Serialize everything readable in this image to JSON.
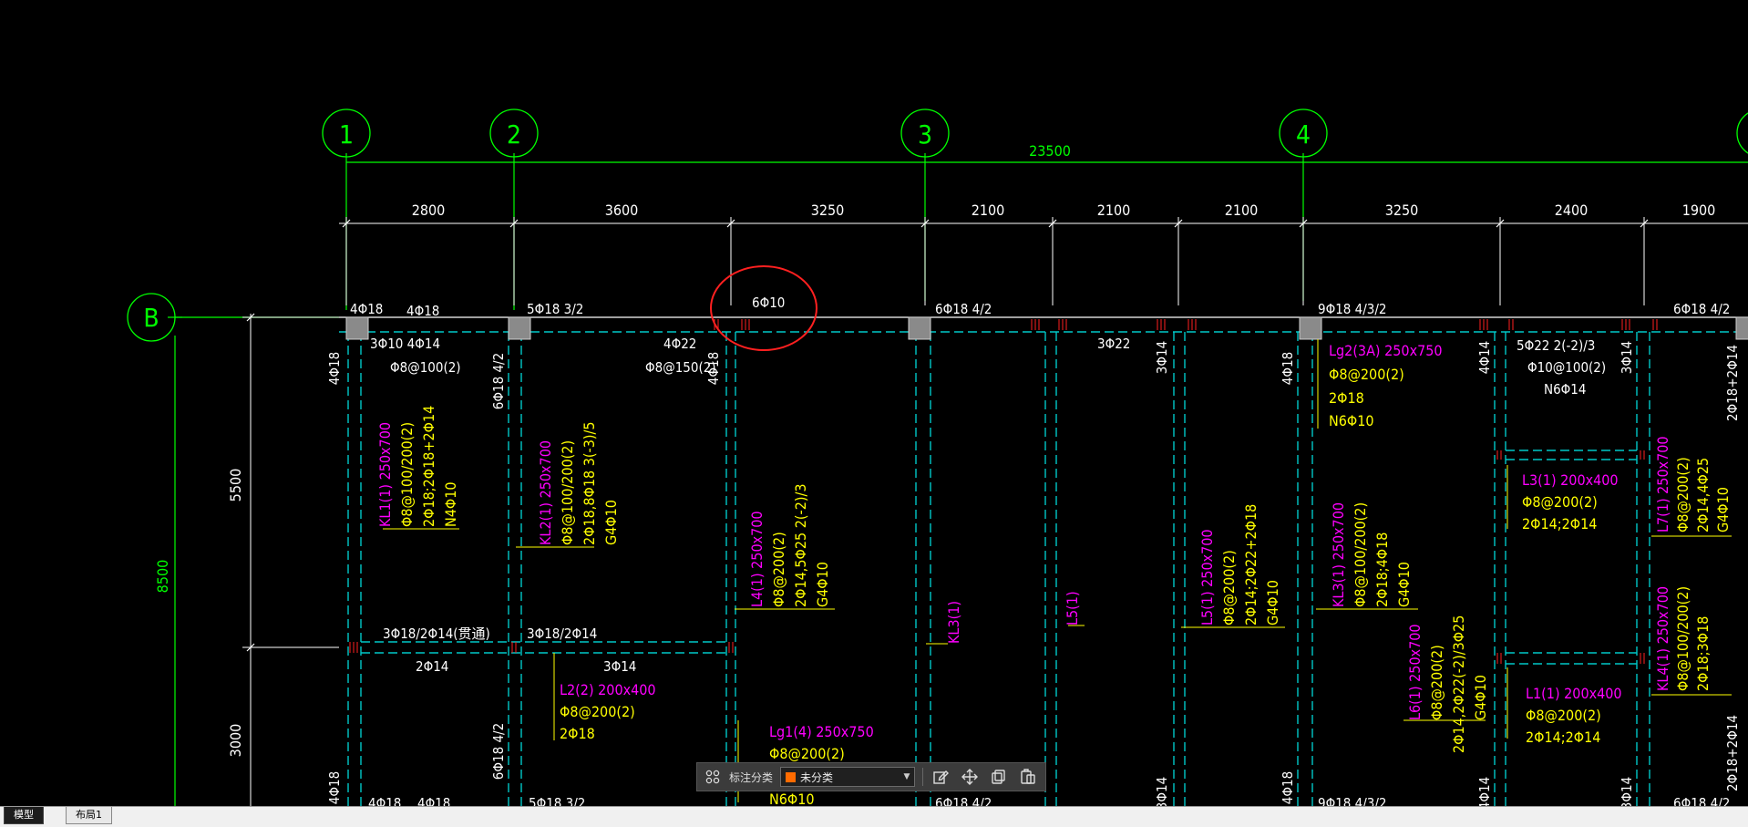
{
  "axes": {
    "columns": [
      "1",
      "2",
      "3",
      "4"
    ],
    "rows": [
      "B"
    ],
    "overall_dim": "23500",
    "left_dim": "8500"
  },
  "dims": {
    "spans": [
      "2800",
      "3600",
      "3250",
      "2100",
      "2100",
      "2100",
      "3250",
      "2400",
      "1900"
    ],
    "vertical": [
      "5500",
      "3000"
    ]
  },
  "labels": {
    "top_row": [
      "4Φ18",
      "4Φ18",
      "5Φ18 3/2",
      "6Φ10",
      "6Φ18 4/2",
      "9Φ18 4/3/2",
      "6Φ18 4/2"
    ],
    "beam_b1": [
      "3Φ10 4Φ14",
      "Φ8@100(2)"
    ],
    "beam_b2": [
      "4Φ22",
      "Φ8@150(2)"
    ],
    "bottom_bar_text": "3Φ22",
    "lg2": [
      "Lg2(3A) 250x750",
      "Φ8@200(2)",
      "2Φ18",
      "N6Φ10"
    ],
    "l_corner": [
      "5Φ22 2(-2)/3",
      "Φ10@100(2)",
      "N6Φ14"
    ],
    "mid_row": [
      "3Φ18/2Φ14(贯通)",
      "3Φ18/2Φ14",
      "2Φ14",
      "3Φ14"
    ],
    "l2": [
      "L2(2) 200x400",
      "Φ8@200(2)",
      "2Φ18"
    ],
    "lg1": [
      "Lg1(4) 250x750",
      "Φ8@200(2)",
      "N6Φ10"
    ],
    "l3": [
      "L3(1) 200x400",
      "Φ8@200(2)",
      "2Φ14;2Φ14"
    ],
    "l1": [
      "L1(1) 200x400",
      "Φ8@200(2)",
      "2Φ14;2Φ14"
    ],
    "bottom_row": [
      "4Φ18",
      "4Φ18",
      "5Φ18 3/2",
      "6Φ18 4/2",
      "9Φ18 4/3/2",
      "6Φ18 4/2"
    ],
    "v_white": [
      "4Φ18",
      "6Φ18 4/2",
      "4Φ18",
      "3Φ14",
      "4Φ18",
      "4Φ14",
      "3Φ14",
      "2Φ18+2Φ14",
      "6Φ18 4/2",
      "4Φ18",
      "3Φ14",
      "4Φ18",
      "4Φ14",
      "3Φ14",
      "2Φ18+2Φ14"
    ],
    "kl1": [
      "KL1(1) 250x700",
      "Φ8@100/200(2)",
      "2Φ18;2Φ18+2Φ14",
      "N4Φ10"
    ],
    "kl2": [
      "KL2(1) 250x700",
      "Φ8@100/200(2)",
      "2Φ18,8Φ18 3(-3)/5",
      "G4Φ10"
    ],
    "l4": [
      "L4(1) 250x700",
      "Φ8@200(2)",
      "2Φ14,5Φ25 2(-2)/3",
      "G4Φ10"
    ],
    "kl3_mid": "KL3(1)",
    "l5_mid": "L5(1)",
    "l5": [
      "L5(1) 250x700",
      "Φ8@200(2)",
      "2Φ14;2Φ22+2Φ18",
      "G4Φ10"
    ],
    "kl3": [
      "KL3(1) 250x700",
      "Φ8@100/200(2)",
      "2Φ18;4Φ18",
      "G4Φ10"
    ],
    "l6": [
      "L6(1) 250x700",
      "Φ8@200(2)",
      "2Φ14,2Φ22(-2)/3Φ25",
      "G4Φ10"
    ],
    "l7": [
      "L7(1) 250x700",
      "Φ8@200(2)",
      "2Φ14,4Φ25",
      "G4Φ10"
    ],
    "kl4": [
      "KL4(1) 250x700",
      "Φ8@100/200(2)",
      "2Φ18;3Φ18"
    ]
  },
  "toolbar": {
    "label": "标注分类",
    "select_value": "未分类",
    "swatch_color": "#ff6b00"
  },
  "tabs": [
    "模型",
    "布局1"
  ],
  "colors": {
    "axis_green": "#00ff00",
    "dim_white": "#ffffff",
    "beam_cyan": "#00c8c8",
    "text_yellow": "#ffff00",
    "text_magenta": "#ff00ff",
    "highlight_red": "#ff0000"
  }
}
